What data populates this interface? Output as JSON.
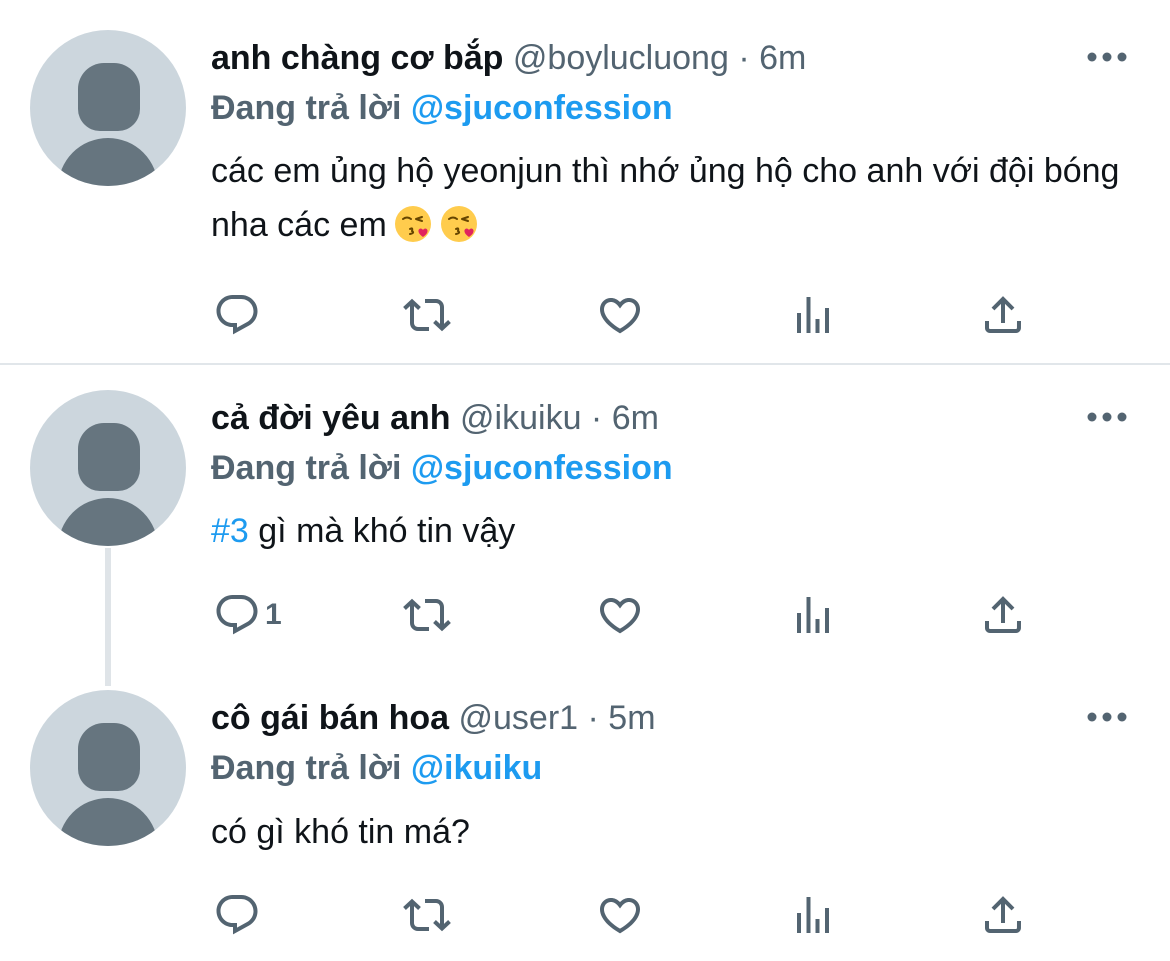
{
  "colors": {
    "accent": "#1d9bf0",
    "secondary": "#536471",
    "avatar_bg": "#ccd6dd",
    "avatar_fg": "#66757f"
  },
  "icons": {
    "reply": "reply-icon",
    "retweet": "retweet-icon",
    "like": "heart-icon",
    "views": "views-icon",
    "share": "share-icon",
    "more": "more-icon",
    "emoji": "kissing-face-emoji"
  },
  "tweets": [
    {
      "name": "anh chàng cơ bắp",
      "handle": "@boylucluong",
      "sep": " · ",
      "time": "6m",
      "reply_prefix": "Đang trả lời ",
      "reply_to": "@sjuconfession",
      "text": "các em ủng hộ yeonjun thì nhớ ủng hộ cho anh với đội bóng nha các em",
      "reply_count": ""
    },
    {
      "name": "cả đời yêu anh",
      "handle": "@ikuiku",
      "sep": " · ",
      "time": "6m",
      "reply_prefix": "Đang trả lời ",
      "reply_to": "@sjuconfession",
      "hashtag": "#3",
      "text": " gì mà khó tin vậy",
      "reply_count": "1"
    },
    {
      "name": "cô gái bán hoa",
      "handle": "@user1",
      "sep": " · ",
      "time": "5m",
      "reply_prefix": "Đang trả lời ",
      "reply_to": "@ikuiku",
      "text": "có gì khó tin má?",
      "reply_count": ""
    }
  ]
}
